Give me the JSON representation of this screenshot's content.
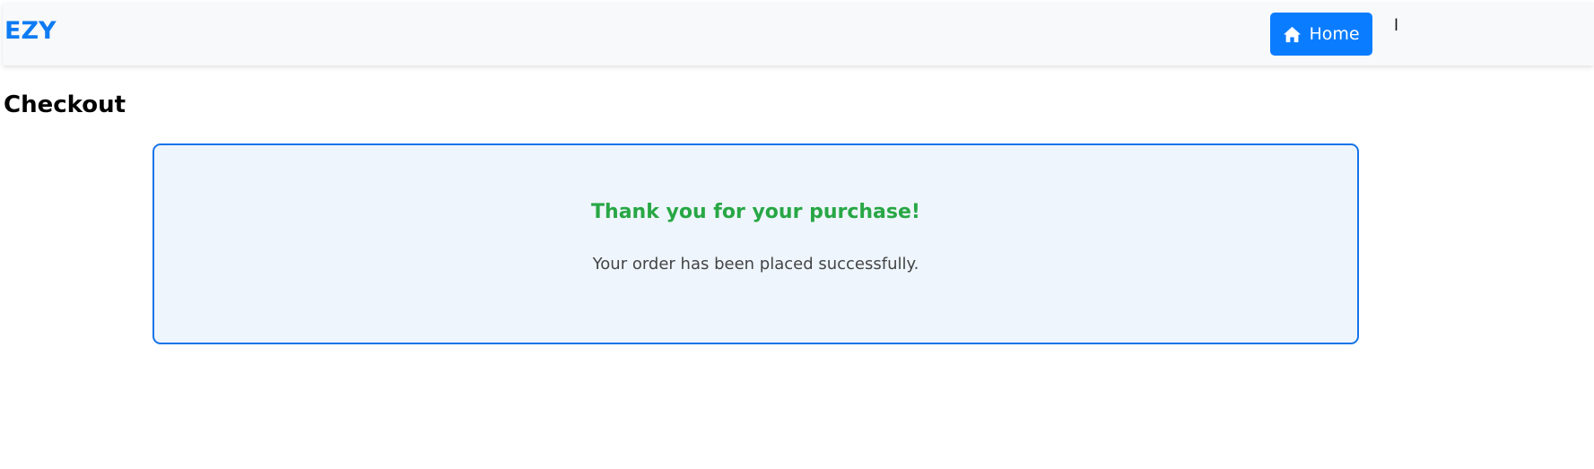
{
  "navbar": {
    "brand": "EZY",
    "home_button": {
      "label": "Home",
      "icon": "home-icon"
    },
    "extra_text": "l"
  },
  "page": {
    "title": "Checkout"
  },
  "confirmation": {
    "heading": "Thank you for your purchase!",
    "message": "Your order has been placed successfully."
  },
  "colors": {
    "brand": "#0d7bf3",
    "primary_button": "#0a7cff",
    "success_text": "#28a745",
    "card_border": "#1874e8",
    "card_background": "#eef5fd"
  }
}
